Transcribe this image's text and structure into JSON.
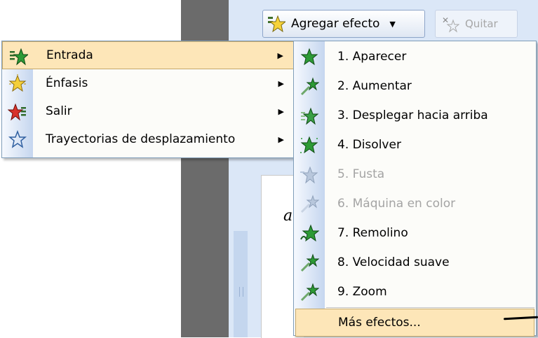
{
  "toolbar": {
    "add_effect_label": "Agregar efecto",
    "remove_label": "Quitar"
  },
  "main_menu": {
    "items": [
      {
        "label": "Entrada",
        "icon": "star-green-icon",
        "highlighted": true
      },
      {
        "label": "Énfasis",
        "icon": "star-yellow-icon",
        "highlighted": false
      },
      {
        "label": "Salir",
        "icon": "star-red-icon",
        "highlighted": false
      },
      {
        "label": "Trayectorias de desplazamiento",
        "icon": "star-outline-icon",
        "highlighted": false
      }
    ]
  },
  "sub_menu": {
    "items": [
      {
        "label": "1. Aparecer",
        "enabled": true
      },
      {
        "label": "2. Aumentar",
        "enabled": true
      },
      {
        "label": "3. Desplegar hacia arriba",
        "enabled": true
      },
      {
        "label": "4. Disolver",
        "enabled": true
      },
      {
        "label": "5. Fusta",
        "enabled": false
      },
      {
        "label": "6. Máquina en color",
        "enabled": false
      },
      {
        "label": "7. Remolino",
        "enabled": true
      },
      {
        "label": "8. Velocidad suave",
        "enabled": true
      },
      {
        "label": "9. Zoom",
        "enabled": true
      }
    ],
    "more_effects_label": "Más efectos..."
  },
  "colors": {
    "highlight": "#fde6b8",
    "menu_border": "#7f9db9",
    "task_pane": "#dbe7f7",
    "divider": "#6b6b6b"
  }
}
